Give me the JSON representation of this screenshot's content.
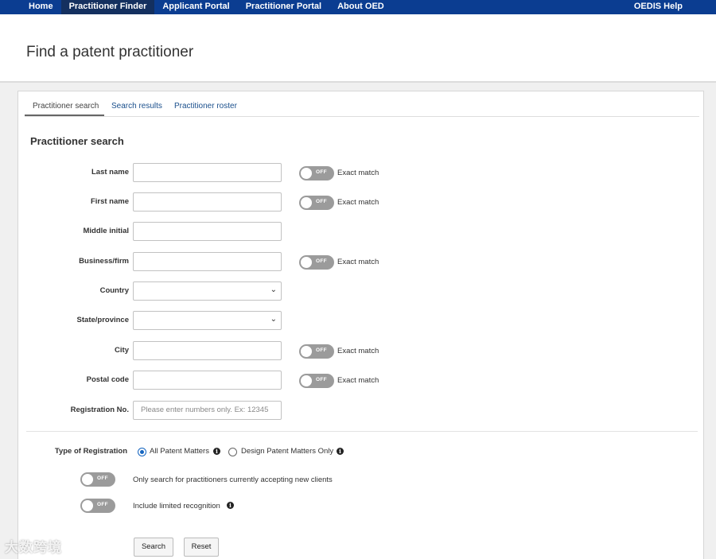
{
  "nav": {
    "items": [
      "Home",
      "Practitioner Finder",
      "Applicant Portal",
      "Practitioner Portal",
      "About OED"
    ],
    "active_index": 1,
    "help": "OEDIS Help"
  },
  "page": {
    "title": "Find a patent practitioner"
  },
  "tabs": [
    "Practitioner search",
    "Search results",
    "Practitioner roster"
  ],
  "form": {
    "section_title": "Practitioner search",
    "last_name": {
      "label": "Last name",
      "value": ""
    },
    "first_name": {
      "label": "First name",
      "value": ""
    },
    "middle_initial": {
      "label": "Middle initial",
      "value": ""
    },
    "business": {
      "label": "Business/firm",
      "value": ""
    },
    "country": {
      "label": "Country",
      "value": ""
    },
    "state": {
      "label": "State/province",
      "value": ""
    },
    "city": {
      "label": "City",
      "value": ""
    },
    "postal": {
      "label": "Postal code",
      "value": ""
    },
    "registration": {
      "label": "Registration No.",
      "placeholder": "Please enter numbers only. Ex: 12345"
    },
    "toggle_off": "OFF",
    "exact_match": "Exact match",
    "type_of_registration": {
      "label": "Type of Registration",
      "options": [
        "All Patent Matters",
        "Design Patent Matters Only"
      ],
      "selected_index": 0
    },
    "accepting_clients": "Only search for practitioners currently accepting new clients",
    "limited_recognition": "Include limited recognition",
    "search_button": "Search",
    "reset_button": "Reset"
  },
  "watermark": "大数跨境",
  "colors": {
    "nav_bg": "#0b3d91",
    "nav_active": "#14305f",
    "link": "#1a4f8c",
    "toggle": "#9b9b9b",
    "radio": "#1565c0"
  }
}
